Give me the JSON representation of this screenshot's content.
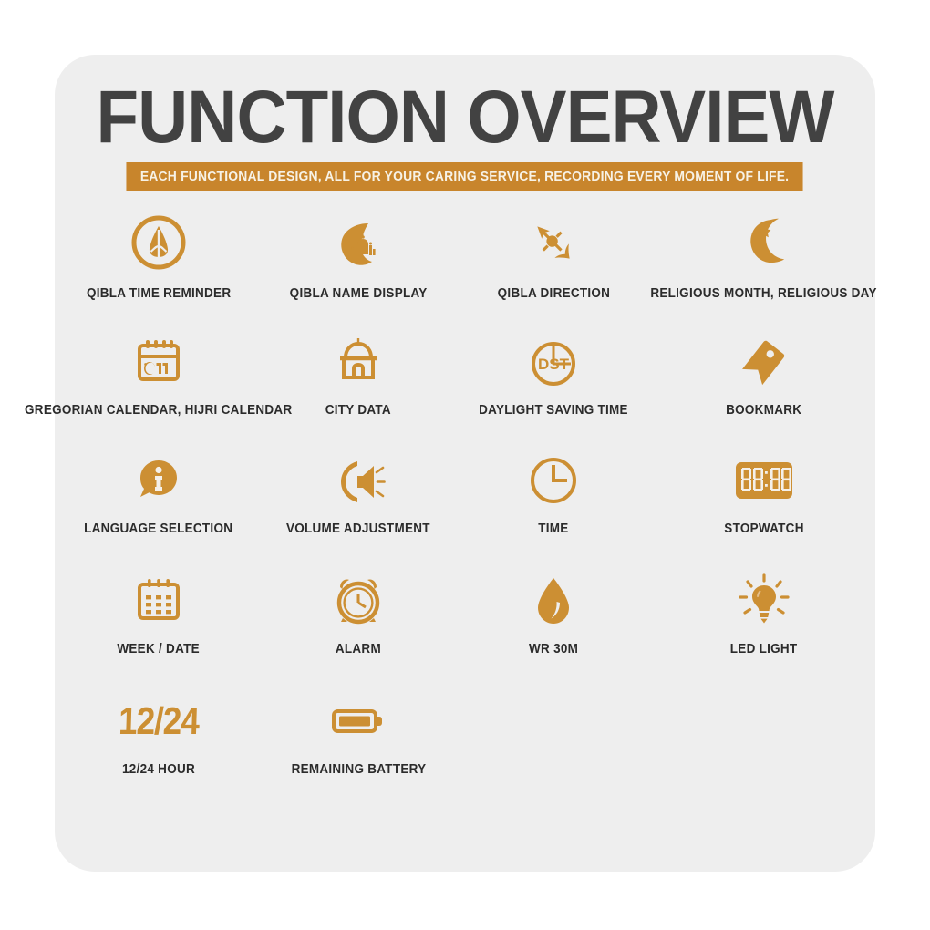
{
  "page": {
    "background": "#ffffff",
    "card_background": "#eeeeee",
    "accent": "#cc8f33",
    "subtitle_bar": "#c8852c",
    "title_color": "#424242",
    "label_color": "#2b2b2b"
  },
  "header": {
    "title": "FUNCTION OVERVIEW",
    "subtitle": "EACH FUNCTIONAL DESIGN, ALL FOR YOUR CARING SERVICE, RECORDING EVERY MOMENT OF LIFE."
  },
  "features": [
    [
      {
        "label": "QIBLA TIME REMINDER",
        "icon": "praying-hands-circle-icon"
      },
      {
        "label": "QIBLA NAME DISPLAY",
        "icon": "crescent-mosque-icon"
      },
      {
        "label": "QIBLA DIRECTION",
        "icon": "compass-needle-icon"
      },
      {
        "label": "RELIGIOUS MONTH, RELIGIOUS DAY",
        "icon": "crescent-star-icon"
      }
    ],
    [
      {
        "label": "GREGORIAN CALENDAR, HIJRI CALENDAR",
        "icon": "calendar-hijri-icon"
      },
      {
        "label": "CITY DATA",
        "icon": "domed-building-icon"
      },
      {
        "label": "DAYLIGHT SAVING TIME",
        "icon": "dst-clock-icon",
        "glyph": "DST"
      },
      {
        "label": "BOOKMARK",
        "icon": "bookmark-tag-icon"
      }
    ],
    [
      {
        "label": "LANGUAGE SELECTION",
        "icon": "info-bubble-icon",
        "glyph": "i"
      },
      {
        "label": "VOLUME ADJUSTMENT",
        "icon": "speaker-volume-icon"
      },
      {
        "label": "TIME",
        "icon": "clock-icon"
      },
      {
        "label": "STOPWATCH",
        "icon": "digital-display-icon",
        "glyph": "00:00"
      }
    ],
    [
      {
        "label": "WEEK / DATE",
        "icon": "calendar-grid-icon"
      },
      {
        "label": "ALARM",
        "icon": "alarm-clock-icon"
      },
      {
        "label": "WR 30M",
        "icon": "water-drop-icon"
      },
      {
        "label": "LED LIGHT",
        "icon": "light-bulb-icon"
      }
    ],
    [
      {
        "label": "12/24 HOUR",
        "icon": "twelve-twentyfour-text-icon",
        "glyph": "12/24"
      },
      {
        "label": "REMAINING BATTERY",
        "icon": "battery-icon"
      }
    ]
  ]
}
